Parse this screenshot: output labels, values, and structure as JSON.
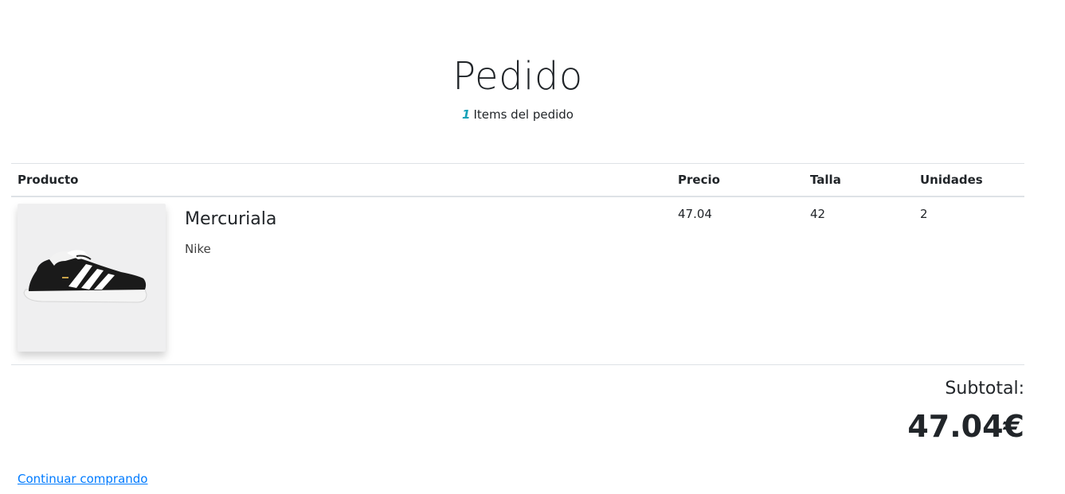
{
  "header": {
    "title": "Pedido",
    "items_count": "1",
    "items_label": "Items del pedido"
  },
  "table": {
    "columns": [
      "Producto",
      "Precio",
      "Talla",
      "Unidades"
    ],
    "rows": [
      {
        "name": "Mercuriala",
        "brand": "Nike",
        "price": "47.04",
        "size": "42",
        "units": "2"
      }
    ]
  },
  "summary": {
    "subtotal_label": "Subtotal:",
    "subtotal_value": "47.04€"
  },
  "footer": {
    "continue_label": "Continuar comprando"
  },
  "colors": {
    "accent_count": "#17a2b8",
    "link": "#007bff",
    "text": "#212529",
    "border": "#dee2e6"
  }
}
